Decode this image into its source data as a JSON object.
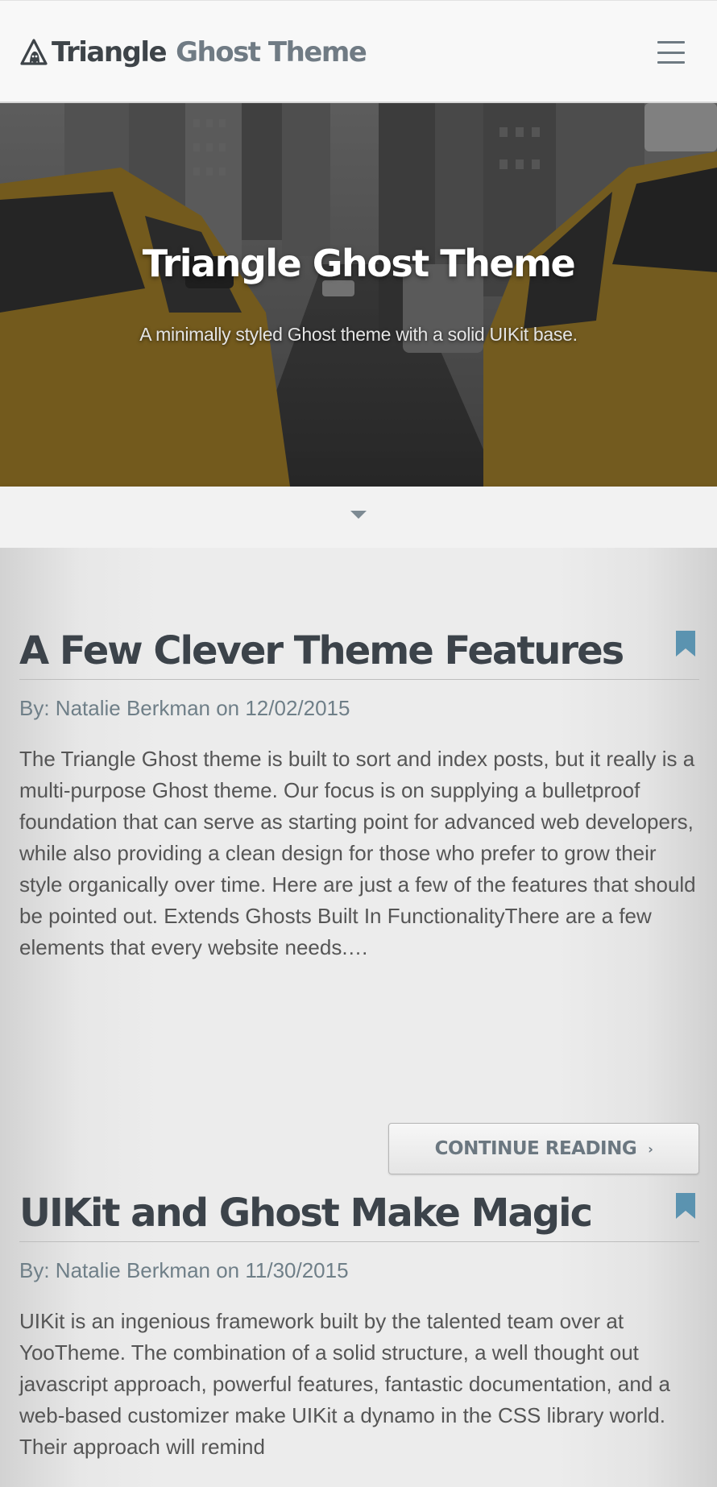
{
  "header": {
    "brand_primary": "Triangle",
    "brand_secondary": "Ghost Theme",
    "menu_icon": "hamburger-menu-icon"
  },
  "hero": {
    "title": "Triangle Ghost Theme",
    "subtitle": "A minimally styled Ghost theme with a solid UIKit base.",
    "scroll_icon": "caret-down-icon"
  },
  "posts": [
    {
      "title": "A Few Clever Theme Features",
      "meta": "By: Natalie Berkman on 12/02/2015",
      "excerpt": "The Triangle Ghost theme is built to sort and index posts, but it really is a multi-purpose Ghost theme. Our focus is on supplying a bulletproof foundation that can serve as starting point for advanced web developers, while also providing a clean design for those who prefer to grow their style organically over time. Here are just a few of the features that should be pointed out. Extends Ghosts Built In FunctionalityThere are a few elements that every website needs.…",
      "button_label": "CONTINUE READING",
      "button_icon": "chevron-right-icon",
      "bookmark_icon": "bookmark-icon"
    },
    {
      "title": "UIKit and Ghost Make Magic",
      "meta": "By: Natalie Berkman on 11/30/2015",
      "excerpt": "UIKit is an ingenious framework built by the talented team over at YooTheme. The combination of a solid structure, a well thought out javascript approach, powerful features, fantastic documentation, and a web-based customizer make UIKit a dynamo in the CSS library world. Their approach will remind",
      "bookmark_icon": "bookmark-icon"
    }
  ],
  "colors": {
    "title_text": "#3c434a",
    "meta_text": "#6f7f88",
    "bookmark": "#5b93b0",
    "brand_secondary": "#707b84"
  }
}
